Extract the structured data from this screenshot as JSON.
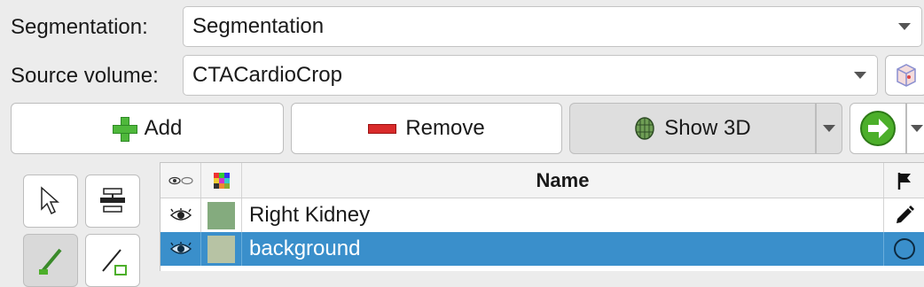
{
  "segmentation": {
    "label": "Segmentation:",
    "value": "Segmentation"
  },
  "source_volume": {
    "label": "Source volume:",
    "value": "CTACardioCrop"
  },
  "buttons": {
    "add": "Add",
    "remove": "Remove",
    "show3d": "Show 3D"
  },
  "table": {
    "header_name": "Name",
    "rows": [
      {
        "name": "Right Kidney",
        "color": "#84ab7e",
        "status": "editing",
        "selected": false
      },
      {
        "name": "background",
        "color": "#b7c3a4",
        "status": "not-started",
        "selected": true
      }
    ]
  },
  "colors": {
    "selection": "#3a8fcb",
    "next_arrow": "#4caf2a"
  },
  "icons": [
    "eye-icon",
    "color-grid-icon",
    "flag-icon",
    "pencil-icon",
    "circle-icon",
    "arrow-pointer-icon",
    "threshold-icon",
    "paint-icon",
    "erase-icon",
    "mesh-icon",
    "next-arrow-icon",
    "cube-icon"
  ]
}
